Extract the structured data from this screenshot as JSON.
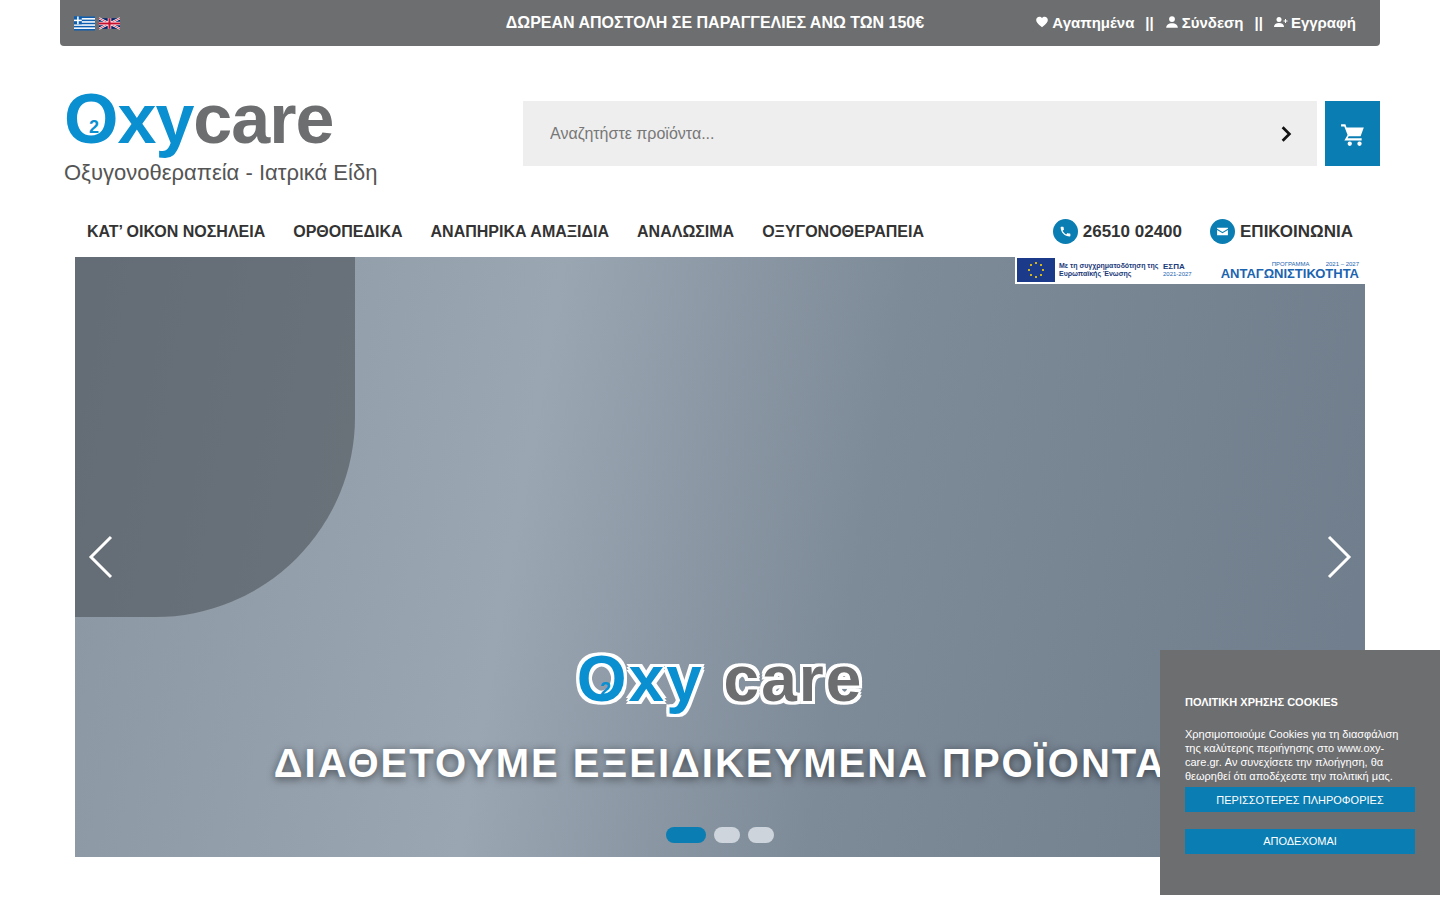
{
  "topbar": {
    "announcement": "ΔΩΡΕΑΝ ΑΠΟΣΤΟΛΗ ΣΕ ΠΑΡΑΓΓΕΛΙΕΣ ΑΝΩ ΤΩΝ 150€",
    "separator": "||",
    "links": [
      {
        "label": "Αγαπημένα",
        "kind": "favorites"
      },
      {
        "label": "Σύνδεση",
        "kind": "login"
      },
      {
        "label": "Εγγραφή",
        "kind": "register"
      }
    ]
  },
  "header": {
    "logo": {
      "o": "O",
      "sub": "2",
      "xy": "xy",
      "care": "care",
      "tagline": "Οξυγονοθεραπεία - Ιατρικά Είδη"
    },
    "search": {
      "placeholder": "Αναζητήστε προϊόντα..."
    }
  },
  "nav": {
    "items": [
      "ΚΑΤ’ ΟΙΚΟΝ ΝΟΣΗΛΕΙΑ",
      "ΟΡΘΟΠΕΔΙΚΑ",
      "ΑΝΑΠΗΡΙΚΑ ΑΜΑΞΙΔΙΑ",
      "ΑΝΑΛΩΣΙΜΑ",
      "ΟΞΥΓΟΝΟΘΕΡΑΠΕΙΑ"
    ],
    "phone": "26510 02400",
    "contact": "ΕΠΙΚΟΙΝΩΝΙΑ"
  },
  "hero": {
    "logo": {
      "o": "O",
      "sub": "2",
      "xy": "xy",
      "care": "care"
    },
    "caption": "ΔΙΑΘΕΤΟΥΜΕ ΕΞΕΙΔΙΚΕΥΜΕΝΑ ΠΡΟΪΟΝΤΑ",
    "slides": [
      {
        "selected": true
      },
      {
        "selected": false
      },
      {
        "selected": false
      }
    ],
    "banner": {
      "cofunding": "Με τη συγχρηματοδότηση της Ευρωπαϊκής Ένωσης",
      "espa": "ΕΣΠΑ",
      "espa_years": "2021-2027",
      "program": "ΠΡΟΓΡΑΜΜΑ",
      "program_years": "2021 – 2027",
      "program_name": "ΑΝΤΑΓΩΝΙΣΤΙΚΟΤΗΤΑ"
    }
  },
  "cookies": {
    "title": "ΠΟΛΙΤΙΚΗ ΧΡΗΣΗΣ COOKIES",
    "text": "Χρησιμοποιούμε Cookies για τη διασφάλιση της καλύτερης περιήγησης στο www.oxy-care.gr. Αν συνεχίσετε την πλοήγηση, θα θεωρηθεί ότι αποδέχεστε την πολιτική μας.",
    "buttons": [
      "ΠΕΡΙΣΣΟΤΕΡΕΣ ΠΛΗΡΟΦΟΡΙΕΣ",
      "ΑΠΟΔΕΧΟΜΑΙ"
    ]
  }
}
